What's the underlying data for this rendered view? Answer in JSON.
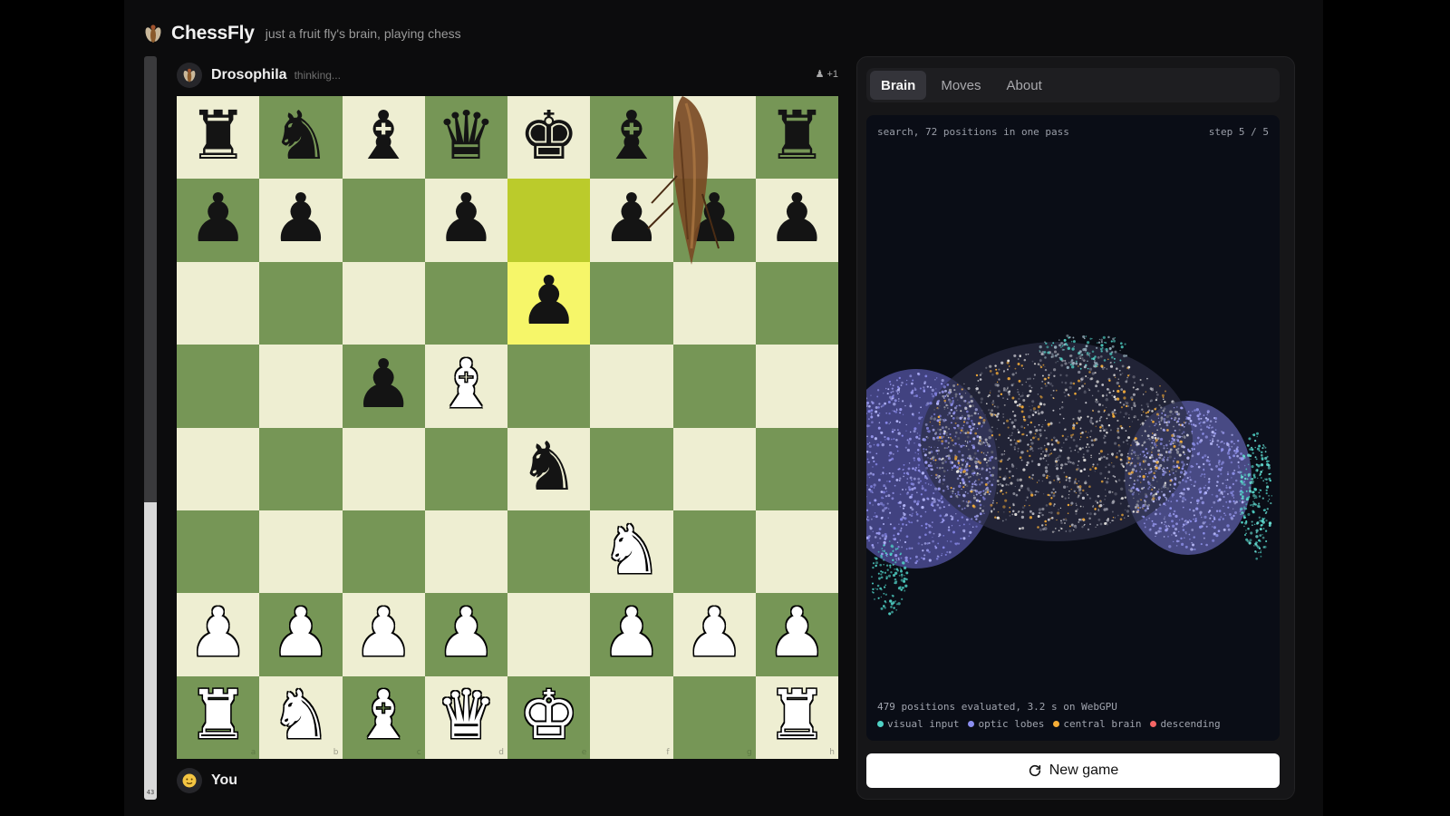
{
  "header": {
    "brand": "ChessFly",
    "tagline": "just a fruit fly's brain, playing chess",
    "logo_icon": "fly-icon"
  },
  "opponent": {
    "name": "Drosophila",
    "status": "thinking...",
    "captured": "+1",
    "avatar_icon": "fly-icon"
  },
  "player": {
    "name": "You",
    "avatar_icon": "face-icon"
  },
  "eval": {
    "label": "43",
    "white_fraction": 0.4
  },
  "board": {
    "colors": {
      "light": "#eeeed2",
      "dark": "#769656",
      "highlight_light": "#f6f669",
      "highlight_dark": "#bbcb2b"
    },
    "files": [
      "a",
      "b",
      "c",
      "d",
      "e",
      "f",
      "g",
      "h"
    ],
    "ranks": [
      [
        "r",
        "n",
        "b",
        "q",
        "k",
        "b",
        "",
        "r"
      ],
      [
        "p",
        "p",
        "",
        "p",
        "",
        "p",
        "p",
        "p"
      ],
      [
        "",
        "",
        "",
        "",
        "p",
        "",
        "",
        ""
      ],
      [
        "",
        "",
        "p",
        "B",
        "",
        "",
        "",
        ""
      ],
      [
        "",
        "",
        "",
        "",
        "n",
        "",
        "",
        ""
      ],
      [
        "",
        "",
        "",
        "",
        "",
        "N",
        "",
        ""
      ],
      [
        "P",
        "P",
        "P",
        "P",
        "",
        "P",
        "P",
        "P"
      ],
      [
        "R",
        "N",
        "B",
        "Q",
        "K",
        "",
        "",
        "R"
      ]
    ],
    "highlight": [
      [
        1,
        4
      ],
      [
        2,
        4
      ]
    ]
  },
  "panel": {
    "tabs": [
      "Brain",
      "Moves",
      "About"
    ],
    "active_tab": 0,
    "search_info": "search, 72 positions in one pass",
    "step": "step 5 / 5",
    "stats": "479 positions evaluated, 3.2 s on WebGPU",
    "legend": [
      {
        "label": "visual input",
        "color": "#4fd1c5"
      },
      {
        "label": "optic lobes",
        "color": "#8b8ef0"
      },
      {
        "label": "central brain",
        "color": "#f6ad37"
      },
      {
        "label": "descending",
        "color": "#f56565"
      }
    ],
    "new_game_label": "New game",
    "new_game_icon": "refresh-icon"
  }
}
